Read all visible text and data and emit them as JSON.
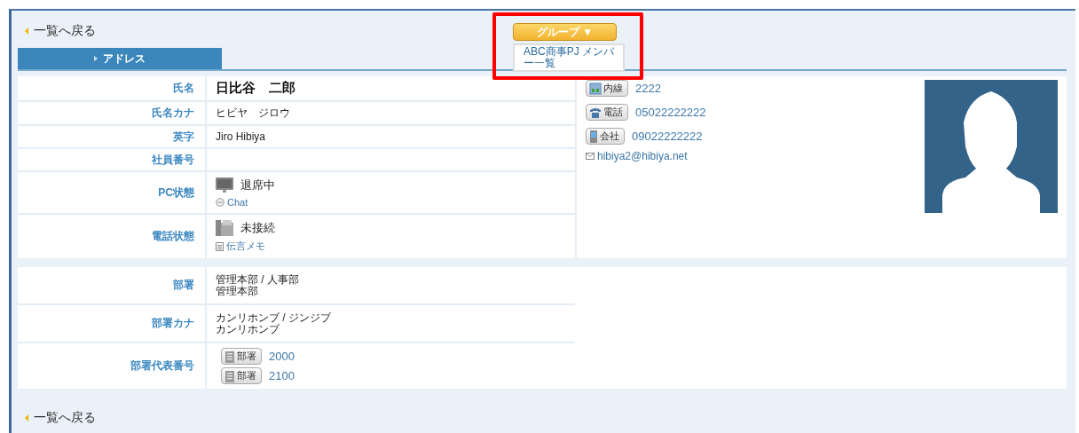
{
  "top_link": "一覧へ戻る",
  "group_button": "グループ ▼",
  "group_menu": {
    "items": [
      "ABC商事PJ メンバー一覧"
    ]
  },
  "tabs": [
    {
      "label": "アドレス",
      "selected": true
    }
  ],
  "person_rows": [
    {
      "label": "氏名",
      "kind": "name",
      "value": "日比谷　二郎"
    },
    {
      "label": "氏名カナ",
      "kind": "text",
      "value": "ヒビヤ　ジロウ"
    },
    {
      "label": "英字",
      "kind": "text",
      "value": "Jiro Hibiya"
    },
    {
      "label": "社員番号",
      "kind": "empty"
    },
    {
      "label": "PC状態",
      "kind": "pc_status",
      "value": "退席中",
      "link": "Chat"
    },
    {
      "label": "電話状態",
      "kind": "phone_status",
      "value": "未接続",
      "link": "伝言メモ"
    }
  ],
  "contacts": [
    {
      "kind": "extension",
      "tag": "内線",
      "number": "2222"
    },
    {
      "kind": "phone",
      "tag": "電話",
      "number": "05022222222"
    },
    {
      "kind": "mobile",
      "tag": "会社",
      "number": "09022222222"
    }
  ],
  "email": "hibiya2@hibiya.net",
  "dept_rows": [
    {
      "label": "部署",
      "kind": "lines",
      "lines": [
        "管理本部 / 人事部",
        "管理本部"
      ]
    },
    {
      "label": "部署カナ",
      "kind": "lines",
      "lines": [
        "カンリホンブ / ジンジブ",
        "カンリホンブ"
      ]
    },
    {
      "label": "部署代表番号",
      "kind": "phones",
      "phones": [
        {
          "tag": "部署",
          "number": "2000"
        },
        {
          "tag": "部署",
          "number": "2100"
        }
      ]
    }
  ],
  "bottom_link": "一覧へ戻る"
}
